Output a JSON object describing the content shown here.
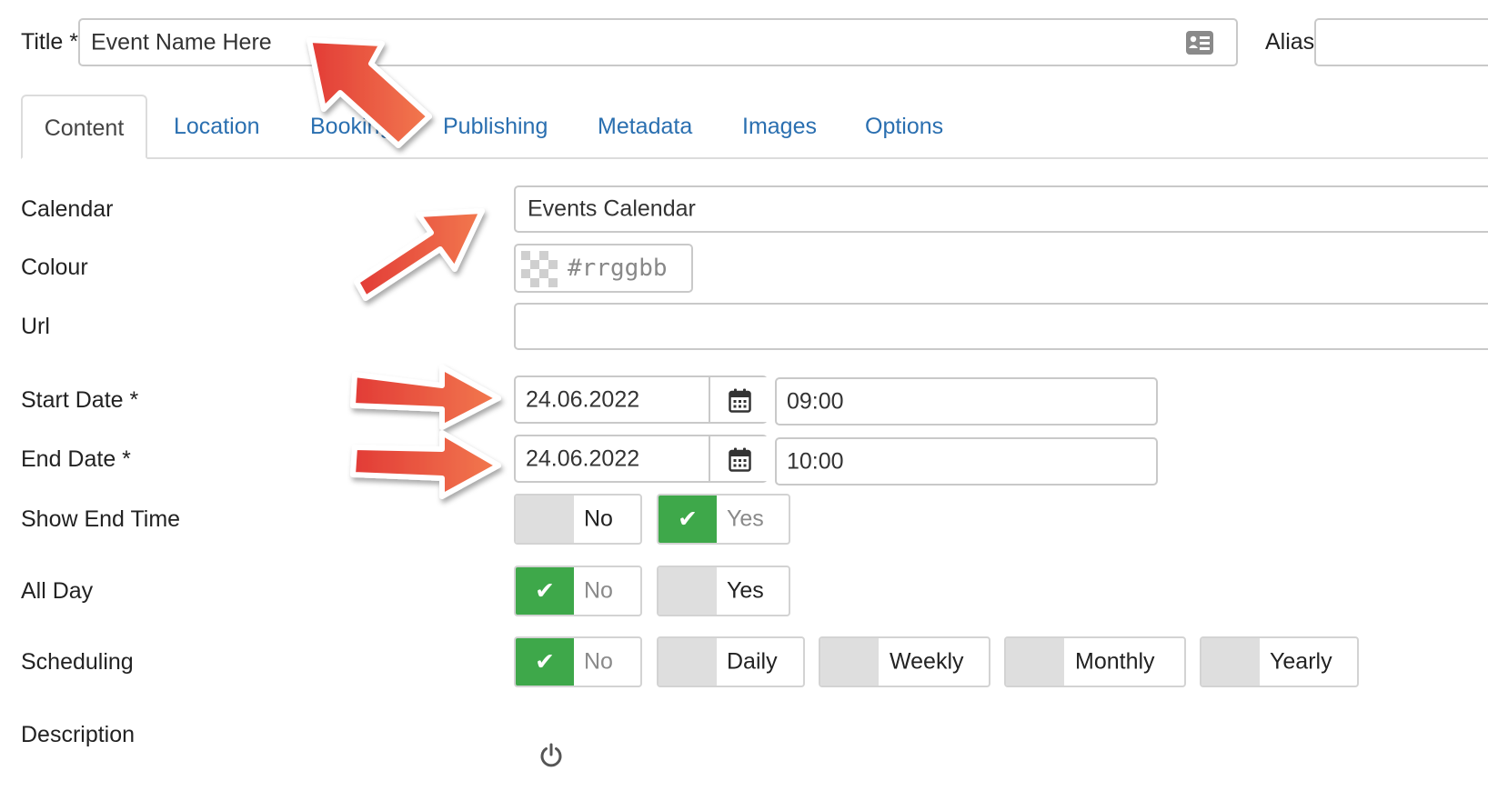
{
  "header": {
    "title_label": "Title *",
    "title_value": "Event Name Here",
    "alias_label": "Alias",
    "title_icon": "contact-card-icon"
  },
  "tabs": [
    {
      "label": "Content",
      "active": true
    },
    {
      "label": "Location"
    },
    {
      "label": "Booking"
    },
    {
      "label": "Publishing"
    },
    {
      "label": "Metadata"
    },
    {
      "label": "Images"
    },
    {
      "label": "Options"
    }
  ],
  "form": {
    "calendar": {
      "label": "Calendar",
      "value": "Events Calendar"
    },
    "colour": {
      "label": "Colour",
      "placeholder": "#rrggbb",
      "icon": "transparent-swatch-icon"
    },
    "url": {
      "label": "Url",
      "value": ""
    },
    "start_date": {
      "label": "Start Date *",
      "date": "24.06.2022",
      "time": "09:00",
      "icon": "calendar-icon"
    },
    "end_date": {
      "label": "End Date *",
      "date": "24.06.2022",
      "time": "10:00",
      "icon": "calendar-icon"
    },
    "show_end_time": {
      "label": "Show End Time",
      "options": [
        {
          "label": "No",
          "selected": false
        },
        {
          "label": "Yes",
          "selected": true
        }
      ]
    },
    "all_day": {
      "label": "All Day",
      "options": [
        {
          "label": "No",
          "selected": true
        },
        {
          "label": "Yes",
          "selected": false
        }
      ]
    },
    "scheduling": {
      "label": "Scheduling",
      "options": [
        {
          "label": "No",
          "selected": true
        },
        {
          "label": "Daily",
          "selected": false
        },
        {
          "label": "Weekly",
          "selected": false
        },
        {
          "label": "Monthly",
          "selected": false
        },
        {
          "label": "Yearly",
          "selected": false
        }
      ]
    },
    "description": {
      "label": "Description",
      "icon": "power-icon"
    }
  },
  "colors": {
    "accent_link": "#2a6fb0",
    "toggle_on": "#3ea84a",
    "toggle_off": "#dedede",
    "annotation_arrow": "#e8473a"
  }
}
